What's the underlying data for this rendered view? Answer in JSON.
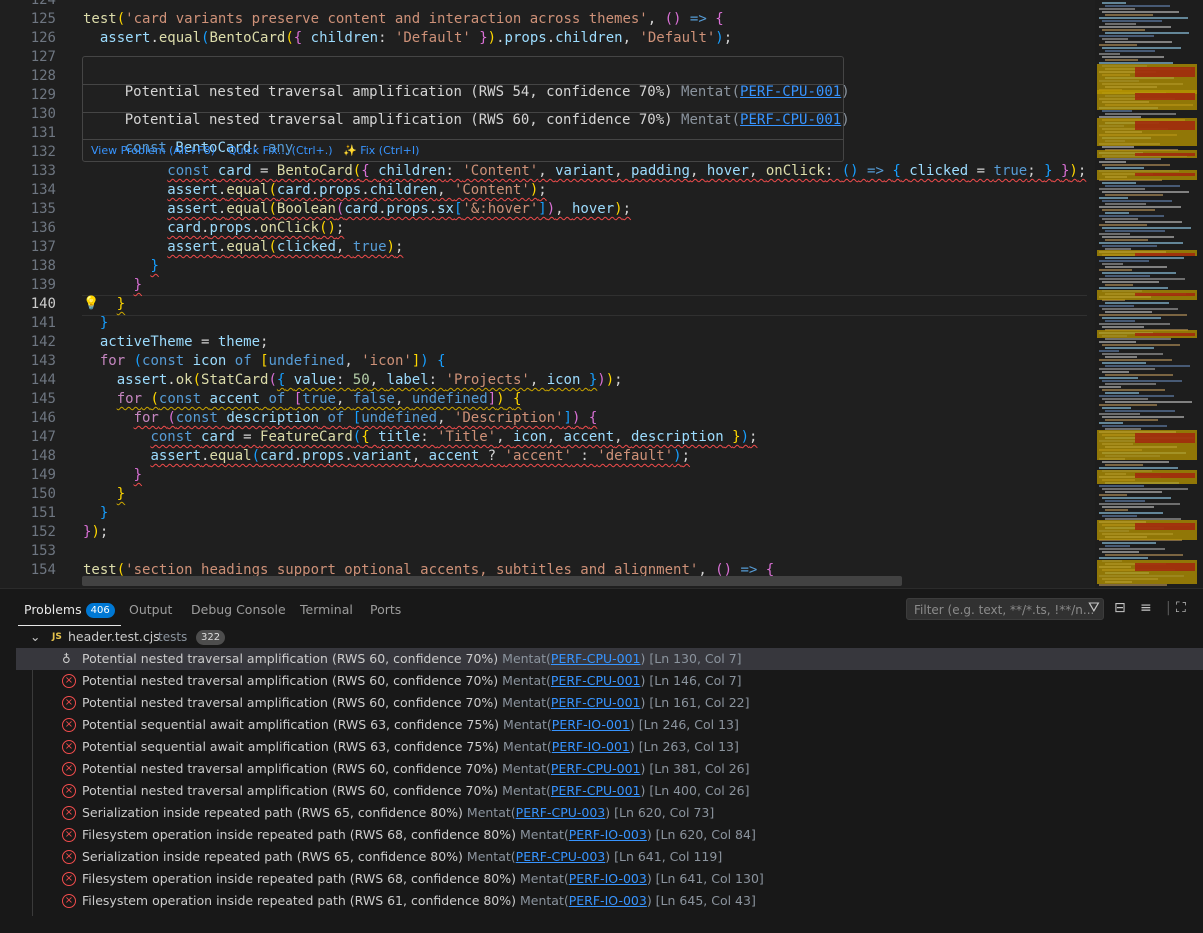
{
  "editor": {
    "lines": [
      {
        "n": "124",
        "html": ""
      },
      {
        "n": "125",
        "html": "<span class=\"f\">test</span><span class=\"b1\">(</span><span class=\"s\">'card variants preserve content and interaction across themes'</span>, <span class=\"b2\">()</span> <span class=\"k\">=&gt;</span> <span class=\"b2\">{</span>"
      },
      {
        "n": "126",
        "html": "  <span class=\"v\">assert</span>.<span class=\"f\">equal</span><span class=\"b3\">(</span><span class=\"f\">BentoCard</span><span class=\"b1\">(</span><span class=\"b2\">{</span> <span class=\"v\">children</span>: <span class=\"s\">'Default'</span> <span class=\"b2\">}</span><span class=\"b1\">)</span>.<span class=\"v\">props</span>.<span class=\"v\">children</span>, <span class=\"s\">'Default'</span><span class=\"b3\">)</span>;"
      },
      {
        "n": "127",
        "html": ""
      },
      {
        "n": "128",
        "html": ""
      },
      {
        "n": "129",
        "html": ""
      },
      {
        "n": "130",
        "html": ""
      },
      {
        "n": "131",
        "html": ""
      },
      {
        "n": "132",
        "html": ""
      },
      {
        "n": "133",
        "html": "          <span class=\"sq\"><span class=\"k\">const</span> <span class=\"v\">card</span> = <span class=\"f\">BentoCard</span><span class=\"b1\">(</span><span class=\"b2\">{</span> <span class=\"v\">children</span>: <span class=\"s\">'Content'</span>, <span class=\"v\">variant</span>, <span class=\"v\">padding</span>, <span class=\"v\">hover</span>, <span class=\"f\">onClick</span>: <span class=\"b3\">()</span> <span class=\"k\">=&gt;</span> <span class=\"b3\">{</span> <span class=\"v\">clicked</span> = <span class=\"k\">true</span>; <span class=\"b3\">}</span> <span class=\"b2\">}</span><span class=\"b1\">)</span>;</span>"
      },
      {
        "n": "134",
        "html": "          <span class=\"sq\"><span class=\"v\">assert</span>.<span class=\"f\">equal</span><span class=\"b1\">(</span><span class=\"v\">card</span>.<span class=\"v\">props</span>.<span class=\"v\">children</span>, <span class=\"s\">'Content'</span><span class=\"b1\">)</span>;</span>"
      },
      {
        "n": "135",
        "html": "          <span class=\"sq\"><span class=\"v\">assert</span>.<span class=\"f\">equal</span><span class=\"b1\">(</span><span class=\"f\">Boolean</span><span class=\"b2\">(</span><span class=\"v\">card</span>.<span class=\"v\">props</span>.<span class=\"v\">sx</span><span class=\"b3\">[</span><span class=\"s\">'&amp;:hover'</span><span class=\"b3\">]</span><span class=\"b2\">)</span>, <span class=\"v\">hover</span><span class=\"b1\">)</span>;</span>"
      },
      {
        "n": "136",
        "html": "          <span class=\"sq\"><span class=\"v\">card</span>.<span class=\"v\">props</span>.<span class=\"f\">onClick</span><span class=\"b1\">()</span>;</span>"
      },
      {
        "n": "137",
        "html": "          <span class=\"sq\"><span class=\"v\">assert</span>.<span class=\"f\">equal</span><span class=\"b1\">(</span><span class=\"v\">clicked</span>, <span class=\"k\">true</span><span class=\"b1\">)</span>;</span>"
      },
      {
        "n": "138",
        "html": "        <span class=\"sq\"><span class=\"b3\">}</span></span>"
      },
      {
        "n": "139",
        "html": "      <span class=\"sq\"><span class=\"b2\">}</span></span>"
      },
      {
        "n": "140",
        "html": "    <span class=\"sqy\"><span class=\"b1\">}</span></span>"
      },
      {
        "n": "141",
        "html": "  <span class=\"b3\">}</span>"
      },
      {
        "n": "142",
        "html": "  <span class=\"v\">activeTheme</span> = <span class=\"v\">theme</span>;"
      },
      {
        "n": "143",
        "html": "  <span class=\"c\">for</span> <span class=\"b3\">(</span><span class=\"k\">const</span> <span class=\"v\">icon</span> <span class=\"k\">of</span> <span class=\"b1\">[</span><span class=\"k\">undefined</span>, <span class=\"s\">'icon'</span><span class=\"b1\">]</span><span class=\"b3\">)</span> <span class=\"b3\">{</span>"
      },
      {
        "n": "144",
        "html": "    <span class=\"v\">assert</span>.<span class=\"f\">ok</span><span class=\"b1\">(</span><span class=\"f\">StatCard</span><span class=\"b2\">(</span><span class=\"sqy\"><span class=\"b3\">{</span> <span class=\"v\">value</span>: <span class=\"n\">50</span>, <span class=\"v\">label</span>: <span class=\"s\">'Projects'</span>, <span class=\"v\">icon</span> <span class=\"b3\">}</span></span><span class=\"b2\">)</span><span class=\"b1\">)</span>;"
      },
      {
        "n": "145",
        "html": "    <span class=\"sqy\"><span class=\"c\">for</span> <span class=\"b1\">(</span><span class=\"k\">const</span> <span class=\"v\">accent</span> <span class=\"k\">of</span> <span class=\"b2\">[</span><span class=\"k\">true</span>, <span class=\"k\">false</span>, <span class=\"k\">undefined</span><span class=\"b2\">]</span><span class=\"b1\">)</span> <span class=\"b1\">{</span></span>"
      },
      {
        "n": "146",
        "html": "      <span class=\"sq\"><span class=\"c\">for</span> <span class=\"b2\">(</span><span class=\"k\">const</span> <span class=\"v\">description</span> <span class=\"k\">of</span> <span class=\"b3\">[</span><span class=\"k\">undefined</span>, <span class=\"s\">'Description'</span><span class=\"b3\">]</span><span class=\"b2\">)</span> <span class=\"b2\">{</span></span>"
      },
      {
        "n": "147",
        "html": "        <span class=\"sq\"><span class=\"k\">const</span> <span class=\"v\">card</span> = <span class=\"f\">FeatureCard</span><span class=\"b3\">(</span><span class=\"b1\">{</span> <span class=\"v\">title</span>: <span class=\"s\">'Title'</span>, <span class=\"v\">icon</span>, <span class=\"v\">accent</span>, <span class=\"v\">description</span> <span class=\"b1\">}</span><span class=\"b3\">)</span>;</span>"
      },
      {
        "n": "148",
        "html": "        <span class=\"sq\"><span class=\"v\">assert</span>.<span class=\"f\">equal</span><span class=\"b3\">(</span><span class=\"v\">card</span>.<span class=\"v\">props</span>.<span class=\"v\">variant</span>, <span class=\"v\">accent</span> ? <span class=\"s\">'accent'</span> : <span class=\"s\">'default'</span><span class=\"b3\">)</span>;</span>"
      },
      {
        "n": "149",
        "html": "      <span class=\"sq\"><span class=\"b2\">}</span></span>"
      },
      {
        "n": "150",
        "html": "    <span class=\"sqy\"><span class=\"b1\">}</span></span>"
      },
      {
        "n": "151",
        "html": "  <span class=\"b3\">}</span>"
      },
      {
        "n": "152",
        "html": "<span class=\"b2\">}</span><span class=\"b1\">)</span>;"
      },
      {
        "n": "153",
        "html": ""
      },
      {
        "n": "154",
        "html": "<span class=\"f\">test</span><span class=\"b1\">(</span><span class=\"s\">'section headings support optional accents, subtitles and alignment'</span>, <span class=\"b2\">()</span> <span class=\"k\">=&gt;</span> <span class=\"b2\">{</span>"
      }
    ]
  },
  "hover": {
    "rows": [
      {
        "message": "Potential nested traversal amplification (RWS 54, confidence 70%)",
        "source": "Mentat(",
        "code": "PERF-CPU-001",
        "close": ")"
      },
      {
        "message": "Potential nested traversal amplification (RWS 60, confidence 70%)",
        "source": "Mentat(",
        "code": "PERF-CPU-001",
        "close": ")"
      }
    ],
    "type_info": "const BentoCard: any",
    "actions": [
      "View Problem (Alt+F8)",
      "Quick Fix... (Ctrl+.)",
      "Fix (Ctrl+I)"
    ]
  },
  "panel": {
    "tabs": [
      "Problems",
      "Output",
      "Debug Console",
      "Terminal",
      "Ports"
    ],
    "problems_count": "406",
    "filter_placeholder": "Filter (e.g. text, **/*.ts, !**/n...",
    "file": {
      "name": "header.test.cjs",
      "folder": "tests",
      "count": "322",
      "icon": "JS"
    },
    "problems": [
      {
        "msg": "Potential nested traversal amplification (RWS 60, confidence 70%)",
        "src": "Mentat(",
        "code": "PERF-CPU-001",
        "pos": ")  [Ln 130, Col 7]",
        "icon": "lightbulb-icon"
      },
      {
        "msg": "Potential nested traversal amplification (RWS 60, confidence 70%)",
        "src": "Mentat(",
        "code": "PERF-CPU-001",
        "pos": ")  [Ln 146, Col 7]",
        "icon": "error-icon"
      },
      {
        "msg": "Potential nested traversal amplification (RWS 60, confidence 70%)",
        "src": "Mentat(",
        "code": "PERF-CPU-001",
        "pos": ")  [Ln 161, Col 22]",
        "icon": "error-icon"
      },
      {
        "msg": "Potential sequential await amplification (RWS 63, confidence 75%)",
        "src": "Mentat(",
        "code": "PERF-IO-001",
        "pos": ")  [Ln 246, Col 13]",
        "icon": "error-icon"
      },
      {
        "msg": "Potential sequential await amplification (RWS 63, confidence 75%)",
        "src": "Mentat(",
        "code": "PERF-IO-001",
        "pos": ")  [Ln 263, Col 13]",
        "icon": "error-icon"
      },
      {
        "msg": "Potential nested traversal amplification (RWS 60, confidence 70%)",
        "src": "Mentat(",
        "code": "PERF-CPU-001",
        "pos": ")  [Ln 381, Col 26]",
        "icon": "error-icon"
      },
      {
        "msg": "Potential nested traversal amplification (RWS 60, confidence 70%)",
        "src": "Mentat(",
        "code": "PERF-CPU-001",
        "pos": ")  [Ln 400, Col 26]",
        "icon": "error-icon"
      },
      {
        "msg": "Serialization inside repeated path (RWS 65, confidence 80%)",
        "src": "Mentat(",
        "code": "PERF-CPU-003",
        "pos": ")  [Ln 620, Col 73]",
        "icon": "error-icon"
      },
      {
        "msg": "Filesystem operation inside repeated path (RWS 68, confidence 80%)",
        "src": "Mentat(",
        "code": "PERF-IO-003",
        "pos": ")  [Ln 620, Col 84]",
        "icon": "error-icon"
      },
      {
        "msg": "Serialization inside repeated path (RWS 65, confidence 80%)",
        "src": "Mentat(",
        "code": "PERF-CPU-003",
        "pos": ")  [Ln 641, Col 119]",
        "icon": "error-icon"
      },
      {
        "msg": "Filesystem operation inside repeated path (RWS 68, confidence 80%)",
        "src": "Mentat(",
        "code": "PERF-IO-003",
        "pos": ")  [Ln 641, Col 130]",
        "icon": "error-icon"
      },
      {
        "msg": "Filesystem operation inside repeated path (RWS 61, confidence 80%)",
        "src": "Mentat(",
        "code": "PERF-IO-003",
        "pos": ")  [Ln 645, Col 43]",
        "icon": "error-icon"
      }
    ]
  }
}
